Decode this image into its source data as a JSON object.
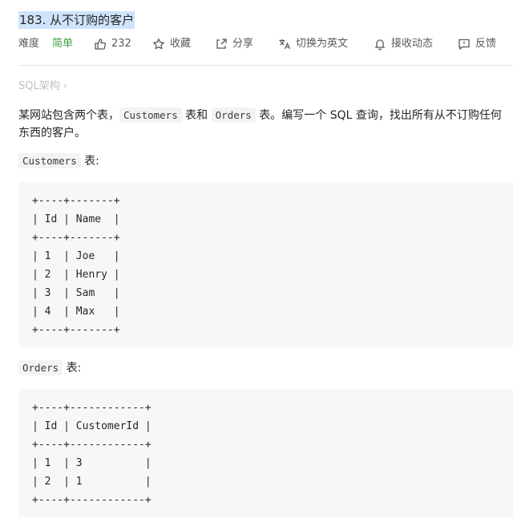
{
  "problem": {
    "title": "183. 从不订购的客户"
  },
  "meta": {
    "difficulty_label": "难度",
    "difficulty_value": "简单",
    "likes": "232",
    "favorite_label": "收藏",
    "share_label": "分享",
    "switch_lang_label": "切换为英文",
    "notifications_label": "接收动态",
    "feedback_label": "反馈"
  },
  "breadcrumb": {
    "text": "SQL架构 ›"
  },
  "description": {
    "part1": "某网站包含两个表，",
    "code1": "Customers",
    "part2": " 表和 ",
    "code2": "Orders",
    "part3": " 表。编写一个 SQL 查询，找出所有从不订购任何东西的客户。"
  },
  "customers_section": {
    "code": "Customers",
    "suffix": " 表:"
  },
  "customers_table": {
    "lines": [
      "+----+-------+",
      "| Id | Name  |",
      "+----+-------+",
      "| 1  | Joe   |",
      "| 2  | Henry |",
      "| 3  | Sam   |",
      "| 4  | Max   |",
      "+----+-------+"
    ]
  },
  "orders_section": {
    "code": "Orders",
    "suffix": " 表:"
  },
  "orders_table": {
    "lines": [
      "+----+------------+",
      "| Id | CustomerId |",
      "+----+------------+",
      "| 1  | 3          |",
      "| 2  | 1          |",
      "+----+------------+"
    ]
  },
  "icons": {
    "likes": "thumbs-up-icon",
    "favorite": "star-icon",
    "share": "share-icon",
    "translate": "translate-icon",
    "notifications": "bell-icon",
    "feedback": "feedback-icon"
  },
  "colors": {
    "difficulty_easy": "#43a047",
    "title_highlight": "#cfe3fb",
    "code_background": "#f7f7f8"
  }
}
